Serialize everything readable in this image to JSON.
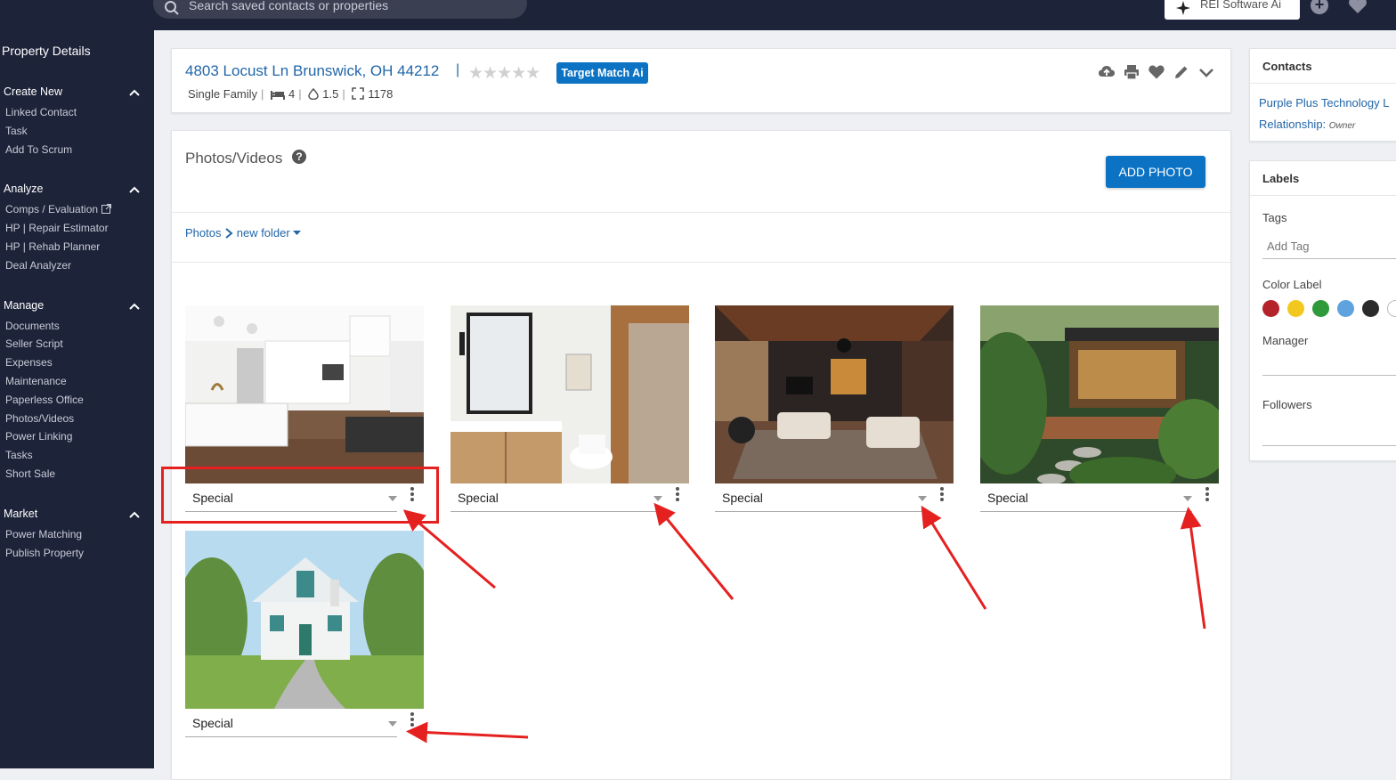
{
  "topbar": {
    "search_placeholder": "Search saved contacts or properties",
    "ai_button_label": "REI Software Ai",
    "plus_label": "+"
  },
  "sidebar": {
    "title": "Property Details",
    "sections": [
      {
        "heading": "Create New",
        "items": [
          "Linked Contact",
          "Task",
          "Add To Scrum"
        ]
      },
      {
        "heading": "Analyze",
        "items": [
          "Comps / Evaluation",
          "HP | Repair Estimator",
          "HP | Rehab Planner",
          "Deal Analyzer"
        ]
      },
      {
        "heading": "Manage",
        "items": [
          "Documents",
          "Seller Script",
          "Expenses",
          "Maintenance",
          "Paperless Office",
          "Photos/Videos",
          "Power Linking",
          "Tasks",
          "Short Sale"
        ]
      },
      {
        "heading": "Market",
        "items": [
          "Power Matching",
          "Publish Property"
        ]
      }
    ]
  },
  "property": {
    "address": "4803 Locust Ln Brunswick, OH 44212",
    "separator": "|",
    "stars": "★★★★★",
    "badge": "Target Match Ai",
    "type": "Single Family",
    "beds": "4",
    "baths": "1.5",
    "sqft": "1178",
    "meta_sep": "|"
  },
  "photos_section": {
    "title": "Photos/Videos",
    "help_icon_label": "?",
    "add_button": "ADD PHOTO",
    "breadcrumb_root": "Photos",
    "breadcrumb_folder": "new folder",
    "photos": [
      {
        "caption": "Special",
        "icon": "kitchen-photo"
      },
      {
        "caption": "Special",
        "icon": "bathroom-photo"
      },
      {
        "caption": "Special",
        "icon": "living-room-photo"
      },
      {
        "caption": "Special",
        "icon": "patio-photo"
      },
      {
        "caption": "Special",
        "icon": "house-exterior-photo"
      }
    ]
  },
  "contacts": {
    "heading": "Contacts",
    "name": "Purple Plus Technology L",
    "relationship_label": "Relationship:",
    "relationship_value": "Owner"
  },
  "labels": {
    "heading": "Labels",
    "tags_label": "Tags",
    "tag_placeholder": "Add Tag",
    "color_label": "Color Label",
    "colors": [
      "#b5232a",
      "#f2c81e",
      "#2f9a3a",
      "#5ea3dd",
      "#2b2b2b",
      "#ffffff"
    ],
    "manager_label": "Manager",
    "followers_label": "Followers"
  },
  "colors": {
    "sidebar_bg": "#1d2339",
    "accent": "#0b72c4",
    "link": "#2266a8",
    "annotation": "#e52120"
  }
}
